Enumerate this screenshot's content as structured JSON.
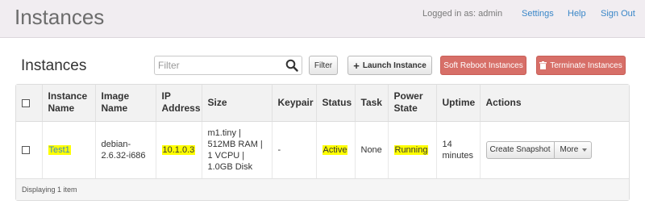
{
  "app": {
    "title": "Instances"
  },
  "user_bar": {
    "logged_in_text": "Logged in as: admin",
    "settings_label": "Settings",
    "help_label": "Help",
    "signout_label": "Sign Out"
  },
  "page": {
    "title": "Instances"
  },
  "toolbar": {
    "filter_placeholder": "Filter",
    "filter_button": "Filter",
    "launch_button": "Launch Instance",
    "soft_reboot_button": "Soft Reboot Instances",
    "terminate_button": "Terminate Instances"
  },
  "table": {
    "headers": {
      "instance_name": "Instance Name",
      "image_name": "Image Name",
      "ip_address": "IP Address",
      "size": "Size",
      "keypair": "Keypair",
      "status": "Status",
      "task": "Task",
      "power_state": "Power State",
      "uptime": "Uptime",
      "actions": "Actions"
    },
    "rows": [
      {
        "instance_name": "Test1",
        "image_name": "debian-2.6.32-i686",
        "ip_address": "10.1.0.3",
        "size_lines": [
          "m1.tiny |",
          "512MB RAM |",
          "1 VCPU |",
          "1.0GB Disk"
        ],
        "keypair": "-",
        "status": "Active",
        "task": "None",
        "power_state": "Running",
        "uptime": "14 minutes",
        "action_primary": "Create Snapshot",
        "action_more": "More"
      }
    ],
    "footer": "Displaying 1 item"
  },
  "colors": {
    "highlight": "#ffff00",
    "link": "#3a87c8",
    "danger": "#d76f68",
    "topbar_bg": "#f1edf1"
  },
  "icons": {
    "search": "search-icon",
    "plus": "plus-icon",
    "trash": "trash-icon",
    "caret": "caret-down-icon"
  }
}
